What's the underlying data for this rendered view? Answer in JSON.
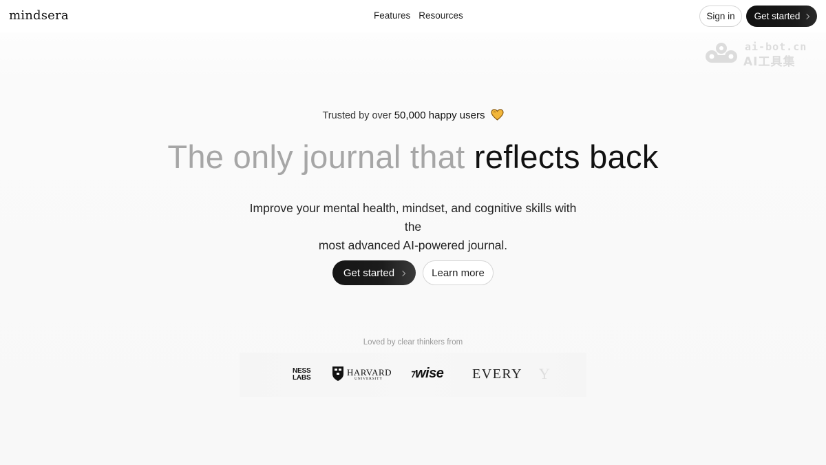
{
  "nav": {
    "logo": "mindsera",
    "links": [
      "Features",
      "Resources"
    ],
    "signin_label": "Sign in",
    "get_started_label": "Get started"
  },
  "watermark": {
    "line1": "ai-bot.cn",
    "line2": "AI工具集"
  },
  "hero": {
    "trusted_prefix": "Trusted by over",
    "trusted_count": "50,000 happy users",
    "headline_light": "The only journal that",
    "headline_dark": "reflects back",
    "subhead_line1": "Improve your mental health, mindset, and cognitive skills with the",
    "subhead_line2": "most advanced AI-powered journal.",
    "cta_primary": "Get started",
    "cta_secondary": "Learn more"
  },
  "social_proof": {
    "caption": "Loved by clear thinkers from",
    "logos": {
      "ness_line1": "NESS",
      "ness_line2": "LABS",
      "harvard_name": "HARVARD",
      "harvard_sub": "UNIVERSITY",
      "wise_flag": "⁊",
      "wise": "wise",
      "every": "EVERY",
      "partial": "Y"
    }
  },
  "colors": {
    "accent_dark": "#111111",
    "heart": "#f2b63a",
    "light_text": "#a6a6a6"
  },
  "icons": [
    "chevron-right-icon",
    "heart-icon",
    "harvard-shield-icon"
  ]
}
